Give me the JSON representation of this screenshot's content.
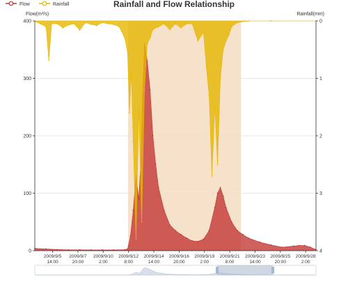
{
  "chart_data": {
    "type": "area",
    "title": "Rainfall and Flow Relationship",
    "legend": {
      "placement": "top-left",
      "items": [
        {
          "name": "Flow",
          "color": "#c23531"
        },
        {
          "name": "Rainfall",
          "color": "#e6b600"
        }
      ]
    },
    "y_left": {
      "label": "Flow(m³/s)",
      "min": 0,
      "max": 400,
      "ticks": [
        0,
        100,
        200,
        300,
        400
      ]
    },
    "y_right": {
      "label": "Rainfall(mm)",
      "min": 0,
      "max": 4,
      "inverse": true,
      "ticks": [
        "0",
        "1",
        "2",
        "3",
        "4"
      ]
    },
    "x_axis": {
      "type": "date",
      "min": "2009-09-04 00:00",
      "max": "2009-09-29 00:00",
      "ticks": [
        {
          "t": "2009-09-05 14:00",
          "lines": [
            "2009/9/5",
            "14:00"
          ]
        },
        {
          "t": "2009-09-07 20:00",
          "lines": [
            "2009/9/7",
            "20:00"
          ]
        },
        {
          "t": "2009-09-10 02:00",
          "lines": [
            "2009/9/10",
            "2:00"
          ]
        },
        {
          "t": "2009-09-12 08:00",
          "lines": [
            "2009/9/12",
            "8:00"
          ]
        },
        {
          "t": "2009-09-14 14:00",
          "lines": [
            "2009/9/14",
            "14:00"
          ]
        },
        {
          "t": "2009-09-16 20:00",
          "lines": [
            "2009/9/16",
            "20:00"
          ]
        },
        {
          "t": "2009-09-19 02:00",
          "lines": [
            "2009/9/19",
            "2:00"
          ]
        },
        {
          "t": "2009-09-21 08:00",
          "lines": [
            "2009/9/21",
            "8:00"
          ]
        },
        {
          "t": "2009-09-23 14:00",
          "lines": [
            "2009/9/23",
            "14:00"
          ]
        },
        {
          "t": "2009-09-25 20:00",
          "lines": [
            "2009/9/25",
            "20:00"
          ]
        },
        {
          "t": "2009-09-28 02:00",
          "lines": [
            "2009/9/28",
            "2:00"
          ]
        }
      ]
    },
    "mark_area": {
      "start": "2009-09-12 07:00",
      "end": "2009-09-22 08:00",
      "color": "#f5dcc2"
    },
    "series": [
      {
        "name": "Flow",
        "axis": "left",
        "color": "#c23531",
        "points": [
          [
            "2009-09-04 00:00",
            4
          ],
          [
            "2009-09-05 00:00",
            3
          ],
          [
            "2009-09-06 00:00",
            2
          ],
          [
            "2009-09-07 00:00",
            1.5
          ],
          [
            "2009-09-08 00:00",
            1.5
          ],
          [
            "2009-09-09 00:00",
            1.3
          ],
          [
            "2009-09-10 00:00",
            1.3
          ],
          [
            "2009-09-11 00:00",
            1.3
          ],
          [
            "2009-09-12 00:00",
            1.8
          ],
          [
            "2009-09-12 06:00",
            3
          ],
          [
            "2009-09-12 12:00",
            25
          ],
          [
            "2009-09-12 18:00",
            70
          ],
          [
            "2009-09-13 00:00",
            130
          ],
          [
            "2009-09-13 06:00",
            90
          ],
          [
            "2009-09-13 10:00",
            150
          ],
          [
            "2009-09-13 14:00",
            270
          ],
          [
            "2009-09-13 18:00",
            360
          ],
          [
            "2009-09-14 00:00",
            330
          ],
          [
            "2009-09-14 06:00",
            280
          ],
          [
            "2009-09-14 12:00",
            200
          ],
          [
            "2009-09-14 18:00",
            150
          ],
          [
            "2009-09-15 00:00",
            110
          ],
          [
            "2009-09-15 12:00",
            70
          ],
          [
            "2009-09-16 00:00",
            45
          ],
          [
            "2009-09-16 12:00",
            35
          ],
          [
            "2009-09-17 00:00",
            28
          ],
          [
            "2009-09-17 12:00",
            22
          ],
          [
            "2009-09-18 00:00",
            17
          ],
          [
            "2009-09-18 12:00",
            16
          ],
          [
            "2009-09-19 00:00",
            20
          ],
          [
            "2009-09-19 12:00",
            35
          ],
          [
            "2009-09-20 00:00",
            75
          ],
          [
            "2009-09-20 06:00",
            100
          ],
          [
            "2009-09-20 12:00",
            110
          ],
          [
            "2009-09-20 18:00",
            95
          ],
          [
            "2009-09-21 00:00",
            75
          ],
          [
            "2009-09-21 12:00",
            50
          ],
          [
            "2009-09-22 00:00",
            35
          ],
          [
            "2009-09-22 12:00",
            28
          ],
          [
            "2009-09-23 00:00",
            22
          ],
          [
            "2009-09-24 00:00",
            15
          ],
          [
            "2009-09-25 00:00",
            10
          ],
          [
            "2009-09-26 00:00",
            6
          ],
          [
            "2009-09-27 00:00",
            8
          ],
          [
            "2009-09-27 12:00",
            9
          ],
          [
            "2009-09-28 00:00",
            9
          ],
          [
            "2009-09-28 12:00",
            6
          ],
          [
            "2009-09-29 00:00",
            2
          ]
        ]
      },
      {
        "name": "Rainfall",
        "axis": "right",
        "color": "#e6b600",
        "points": [
          [
            "2009-09-04 00:00",
            0.01
          ],
          [
            "2009-09-04 12:00",
            0.05
          ],
          [
            "2009-09-05 00:00",
            0.1
          ],
          [
            "2009-09-05 06:00",
            0.68
          ],
          [
            "2009-09-05 12:00",
            0.05
          ],
          [
            "2009-09-06 00:00",
            0.05
          ],
          [
            "2009-09-06 12:00",
            0.12
          ],
          [
            "2009-09-07 00:00",
            0.07
          ],
          [
            "2009-09-07 12:00",
            0.05
          ],
          [
            "2009-09-08 00:00",
            0.16
          ],
          [
            "2009-09-08 12:00",
            0.03
          ],
          [
            "2009-09-09 00:00",
            0.06
          ],
          [
            "2009-09-09 12:00",
            0.08
          ],
          [
            "2009-09-10 00:00",
            0.03
          ],
          [
            "2009-09-10 12:00",
            0.05
          ],
          [
            "2009-09-11 00:00",
            0.06
          ],
          [
            "2009-09-11 12:00",
            0.1
          ],
          [
            "2009-09-12 00:00",
            0.3
          ],
          [
            "2009-09-12 06:00",
            0.55
          ],
          [
            "2009-09-12 10:00",
            1.6
          ],
          [
            "2009-09-12 14:00",
            0.9
          ],
          [
            "2009-09-12 18:00",
            2.1
          ],
          [
            "2009-09-13 00:00",
            3.8
          ],
          [
            "2009-09-13 06:00",
            1.5
          ],
          [
            "2009-09-13 12:00",
            3.5
          ],
          [
            "2009-09-13 18:00",
            1.2
          ],
          [
            "2009-09-14 00:00",
            0.4
          ],
          [
            "2009-09-14 06:00",
            0.3
          ],
          [
            "2009-09-14 12:00",
            0.15
          ],
          [
            "2009-09-15 00:00",
            0.1
          ],
          [
            "2009-09-15 12:00",
            0.05
          ],
          [
            "2009-09-16 00:00",
            0.15
          ],
          [
            "2009-09-16 12:00",
            0.05
          ],
          [
            "2009-09-17 00:00",
            0.12
          ],
          [
            "2009-09-17 12:00",
            0.05
          ],
          [
            "2009-09-18 00:00",
            0.05
          ],
          [
            "2009-09-18 12:00",
            0.35
          ],
          [
            "2009-09-19 00:00",
            0.2
          ],
          [
            "2009-09-19 06:00",
            0.8
          ],
          [
            "2009-09-19 12:00",
            1.3
          ],
          [
            "2009-09-19 18:00",
            2.7
          ],
          [
            "2009-09-20 00:00",
            1.5
          ],
          [
            "2009-09-20 06:00",
            2.5
          ],
          [
            "2009-09-20 12:00",
            1.0
          ],
          [
            "2009-09-20 18:00",
            0.5
          ],
          [
            "2009-09-21 00:00",
            0.35
          ],
          [
            "2009-09-21 06:00",
            0.25
          ],
          [
            "2009-09-21 12:00",
            0.1
          ],
          [
            "2009-09-22 00:00",
            0.03
          ],
          [
            "2009-09-23 00:00",
            0.0
          ],
          [
            "2009-09-25 00:00",
            0.0
          ],
          [
            "2009-09-29 00:00",
            0.0
          ]
        ]
      }
    ]
  }
}
